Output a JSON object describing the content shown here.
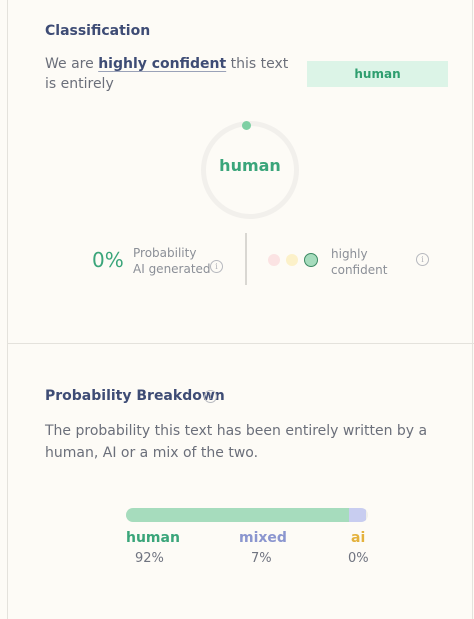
{
  "classification": {
    "title": "Classification",
    "confidence_prefix": "We are ",
    "confidence_strong": "highly confident",
    "confidence_suffix": " this text is entirely",
    "badge_label": "human",
    "ring_label": "human",
    "probability_value": "0%",
    "probability_label_line1": "Probability",
    "probability_label_line2": "AI generated",
    "confidence_level_line1": "highly",
    "confidence_level_line2": "confident",
    "confidence_dots": [
      {
        "name": "low",
        "color": "#fbe3e3"
      },
      {
        "name": "medium",
        "color": "#fcf1c9"
      },
      {
        "name": "high",
        "color": "#a6dcbd",
        "active": true
      }
    ]
  },
  "breakdown": {
    "title": "Probability Breakdown",
    "description": "The probability this text has been entirely written by a human, AI or a mix of the two.",
    "categories": [
      {
        "label": "human",
        "value": "92%",
        "fraction": 0.92,
        "color": "#a6dcbd",
        "text_color": "#3aa57a"
      },
      {
        "label": "mixed",
        "value": "7%",
        "fraction": 0.07,
        "color": "#c8cdf0",
        "text_color": "#8b96cf"
      },
      {
        "label": "ai",
        "value": "0%",
        "fraction": 0.0,
        "color": "#f4d58a",
        "text_color": "#e4b23d"
      }
    ]
  }
}
